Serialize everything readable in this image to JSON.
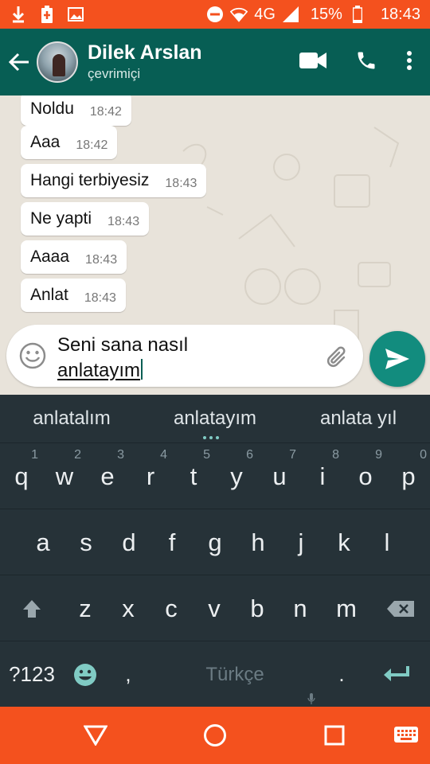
{
  "status_bar": {
    "network": "4G",
    "battery": "15%",
    "time": "18:43"
  },
  "header": {
    "contact_name": "Dilek Arslan",
    "contact_status": "çevrimiçi"
  },
  "messages": [
    {
      "text": "Noldu",
      "time": "18:42"
    },
    {
      "text": "Aaa",
      "time": "18:42"
    },
    {
      "text": "Hangi terbiyesiz",
      "time": "18:43"
    },
    {
      "text": "Ne yapti",
      "time": "18:43"
    },
    {
      "text": "Aaaa",
      "time": "18:43"
    },
    {
      "text": "Anlat",
      "time": "18:43"
    }
  ],
  "composer": {
    "line1": "Seni sana nasıl",
    "line2": "anlatayım"
  },
  "keyboard": {
    "suggestions": [
      "anlatalım",
      "anlatayım",
      "anlata yıl"
    ],
    "row1": [
      "q",
      "w",
      "e",
      "r",
      "t",
      "y",
      "u",
      "i",
      "o",
      "p"
    ],
    "row1_hints": [
      "1",
      "2",
      "3",
      "4",
      "5",
      "6",
      "7",
      "8",
      "9",
      "0"
    ],
    "row2": [
      "a",
      "s",
      "d",
      "f",
      "g",
      "h",
      "j",
      "k",
      "l"
    ],
    "row3": [
      "z",
      "x",
      "c",
      "v",
      "b",
      "n",
      "m"
    ],
    "symbols_key": "?123",
    "comma_key": ",",
    "space_label": "Türkçe",
    "period_key": "."
  },
  "colors": {
    "status_bar": "#f4511e",
    "app_bar": "#075e54",
    "send_button": "#128c7e",
    "keyboard_bg": "#263238",
    "nav_bar": "#f4511e"
  }
}
